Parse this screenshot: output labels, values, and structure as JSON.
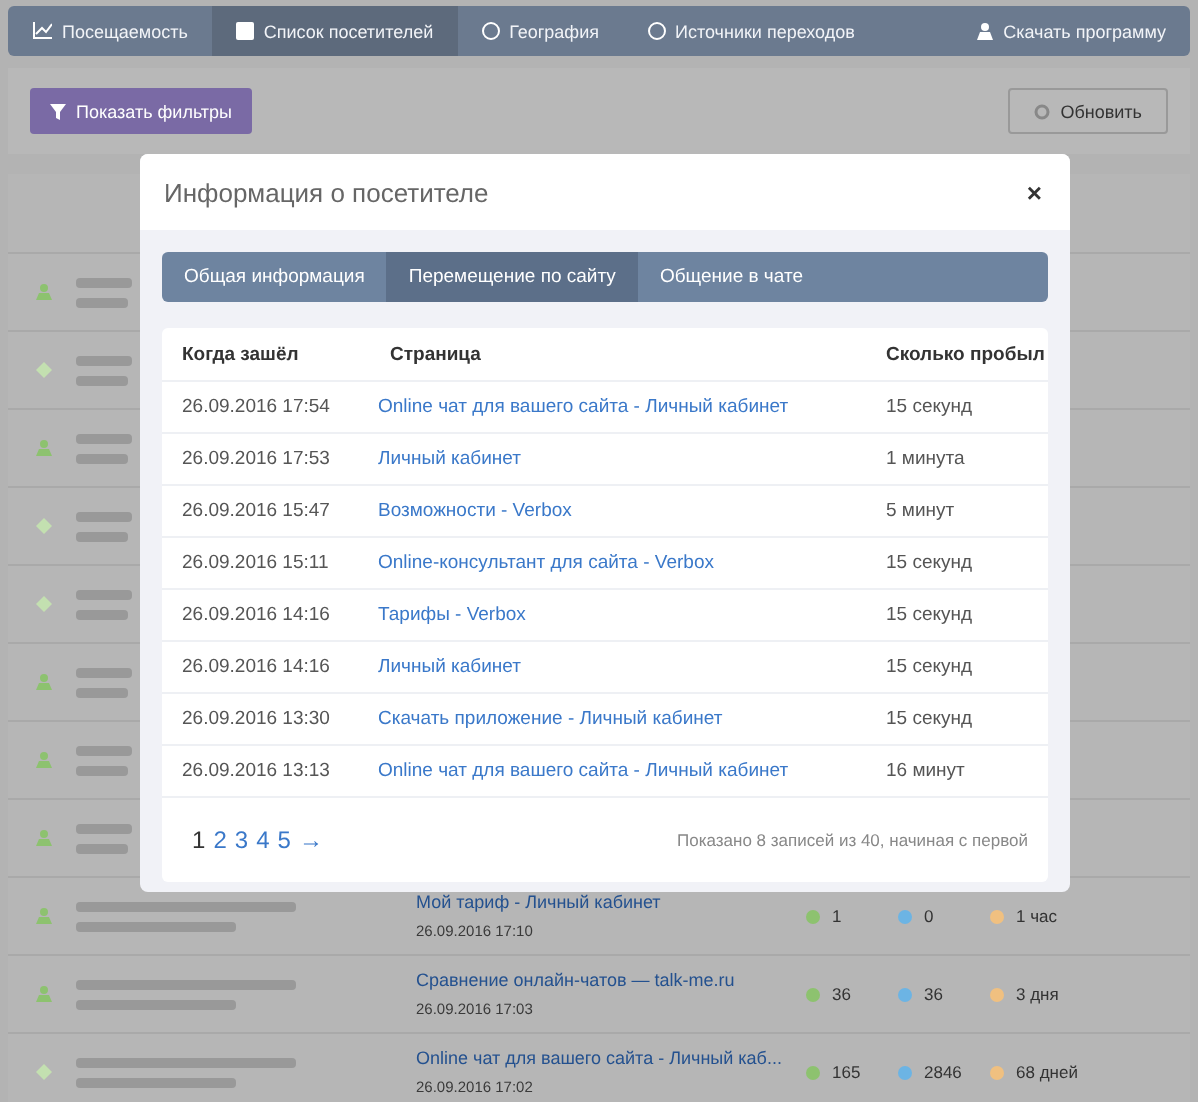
{
  "nav": {
    "items": [
      {
        "label": "Посещаемость",
        "selected": false
      },
      {
        "label": "Список посетителей",
        "selected": true
      },
      {
        "label": "География",
        "selected": false
      },
      {
        "label": "Источники переходов",
        "selected": false
      }
    ],
    "download": {
      "label": "Скачать программу"
    }
  },
  "toolbar": {
    "filters_button": "Показать фильтры",
    "refresh_button": "Обновить"
  },
  "visitors": [
    {
      "online": true
    },
    {
      "online": false
    },
    {
      "online": true
    },
    {
      "online": false
    },
    {
      "online": false
    },
    {
      "online": true
    },
    {
      "online": true
    },
    {
      "online": true
    },
    {
      "online": true,
      "page": "Мой тариф - Личный кабинет",
      "time": "26.09.2016 17:10",
      "stats": [
        "1",
        "0",
        "1 час"
      ]
    },
    {
      "online": true,
      "page": "Сравнение онлайн-чатов — talk-me.ru",
      "time": "26.09.2016 17:03",
      "stats": [
        "36",
        "36",
        "3 дня"
      ]
    },
    {
      "online": false,
      "page": "Online чат для вашего сайта - Личный каб...",
      "time": "26.09.2016 17:02",
      "stats": [
        "165",
        "2846",
        "68 дней"
      ]
    }
  ],
  "modal": {
    "title": "Информация о посетителе",
    "close": "×",
    "tabs": [
      {
        "label": "Общая информация",
        "selected": false
      },
      {
        "label": "Перемещение по сайту",
        "selected": true
      },
      {
        "label": "Общение в чате",
        "selected": false
      }
    ],
    "table": {
      "columns": [
        "Когда зашёл",
        "Страница",
        "Сколько пробыл"
      ],
      "rows": [
        [
          "26.09.2016 17:54",
          "Online чат для вашего сайта - Личный кабинет",
          "15 секунд"
        ],
        [
          "26.09.2016 17:53",
          "Личный кабинет",
          "1 минута"
        ],
        [
          "26.09.2016 15:47",
          "Возможности - Verbox",
          "5 минут"
        ],
        [
          "26.09.2016 15:11",
          "Online-консультант для сайта - Verbox",
          "15 секунд"
        ],
        [
          "26.09.2016 14:16",
          "Тарифы - Verbox",
          "15 секунд"
        ],
        [
          "26.09.2016 14:16",
          "Личный кабинет",
          "15 секунд"
        ],
        [
          "26.09.2016 13:30",
          "Скачать приложение - Личный кабинет",
          "15 секунд"
        ],
        [
          "26.09.2016 13:13",
          "Online чат для вашего сайта - Личный кабинет",
          "16 минут"
        ]
      ]
    },
    "pagination": {
      "pages": [
        {
          "label": "1",
          "selected": true
        },
        {
          "label": "2",
          "selected": false
        },
        {
          "label": "3",
          "selected": false
        },
        {
          "label": "4",
          "selected": false
        },
        {
          "label": "5",
          "selected": false
        }
      ],
      "next": "→"
    },
    "summary": "Показано 8 записей из 40, начиная с первой"
  }
}
